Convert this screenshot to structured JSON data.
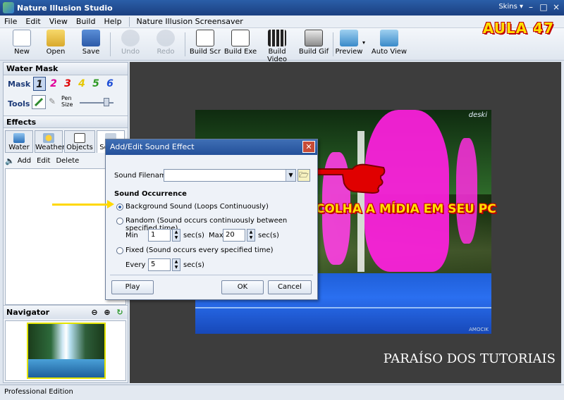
{
  "window": {
    "title": "Nature Illusion Studio",
    "skins_label": "Skins",
    "min": "–",
    "max": "□",
    "close": "×"
  },
  "menu": {
    "items": [
      "File",
      "Edit",
      "View",
      "Build",
      "Help"
    ],
    "screensaver": "Nature Illusion Screensaver"
  },
  "toolbar": {
    "new": "New",
    "open": "Open",
    "save": "Save",
    "undo": "Undo",
    "redo": "Redo",
    "build_scr": "Build Scr",
    "build_exe": "Build Exe",
    "build_video": "Build Video",
    "build_gif": "Build Gif",
    "preview": "Preview",
    "auto_view": "Auto View"
  },
  "overlay": {
    "aula": "AULA 47",
    "callout": "ESCOLHA A MÍDIA EM SEU PC",
    "watermark": "PARAÍSO DOS TUTORIAIS"
  },
  "left_panel": {
    "water_mask_title": "Water Mask",
    "mask_label": "Mask",
    "mask_numbers": [
      "1",
      "2",
      "3",
      "4",
      "5",
      "6"
    ],
    "mask_colors": [
      "#1a1a1a",
      "#e0009a",
      "#e00000",
      "#e6c800",
      "#2f9a24",
      "#1f4fd6"
    ],
    "tools_label": "Tools",
    "pen_size_line1": "Pen",
    "pen_size_line2": "Size",
    "effects_title": "Effects",
    "effect_tabs": [
      "Water",
      "Weather",
      "Objects",
      "Sound"
    ],
    "sound_tools": [
      "Add",
      "Edit",
      "Delete"
    ],
    "navigator_title": "Navigator"
  },
  "dialog": {
    "title": "Add/Edit Sound Effect",
    "sound_filename_label": "Sound Filename",
    "sound_filename_value": "",
    "occurrence_title": "Sound Occurrence",
    "opt_background": "Background Sound (Loops Continuously)",
    "opt_random": "Random (Sound occurs continuously between specified time)",
    "min_label": "Min",
    "min_value": "1",
    "max_label": "Max",
    "max_value": "20",
    "secs": "sec(s)",
    "opt_fixed": "Fixed (Sound occurs every specified time)",
    "every_label": "Every",
    "every_value": "5",
    "play": "Play",
    "ok": "OK",
    "cancel": "Cancel"
  },
  "photo": {
    "logo": "deski",
    "credit": "AMOCIK"
  },
  "statusbar": {
    "edition": "Professional Edition"
  }
}
